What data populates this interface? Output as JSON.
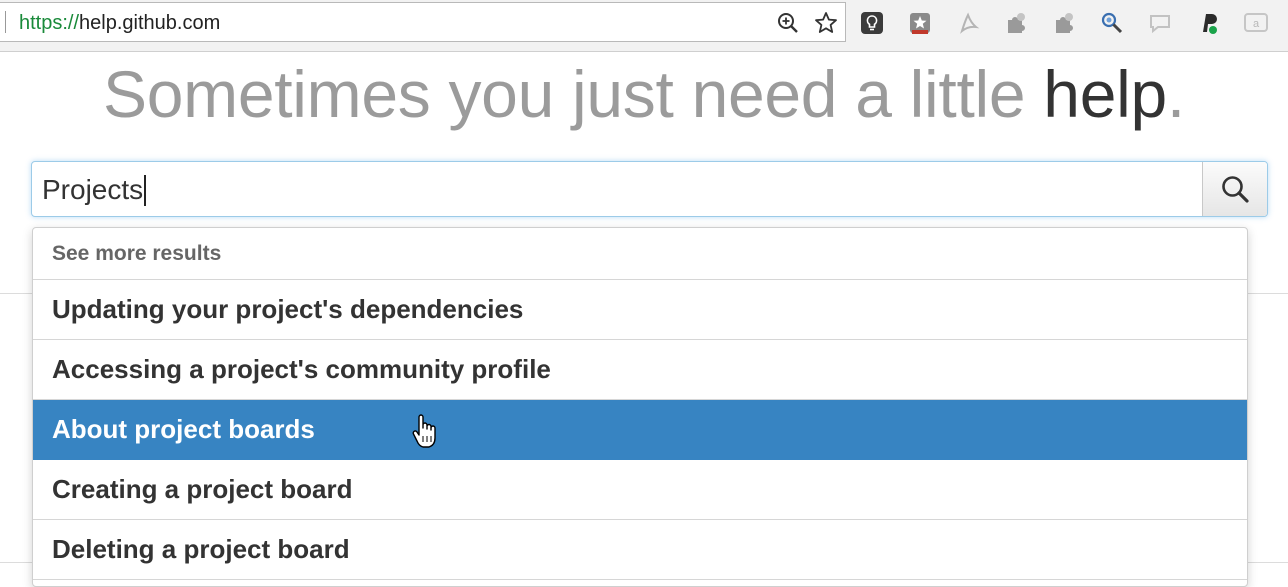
{
  "browser": {
    "url_scheme": "https://",
    "url_host": "help.github.com",
    "toolbar_icons": [
      "zoom-icon",
      "bookmark-star-icon"
    ],
    "extensions": [
      "lightbulb-extension-icon",
      "badge-extension-icon",
      "pdf-extension-icon",
      "puzzle-extension-icon",
      "puzzle-extension-icon-2",
      "search-bug-extension-icon",
      "chat-extension-icon",
      "paypal-extension-icon",
      "amazon-extension-icon"
    ]
  },
  "page": {
    "headline_light": "Sometimes you just need a little",
    "headline_strong": "help",
    "headline_end": "."
  },
  "search": {
    "value": "Projects",
    "button_icon": "search-icon"
  },
  "dropdown": {
    "see_more": "See more results",
    "results": [
      "Updating your project's dependencies",
      "Accessing a project's community profile",
      "About project boards",
      "Creating a project board",
      "Deleting a project board"
    ],
    "active_index": 2,
    "active_color": "#3784c2"
  },
  "colors": {
    "headline_light": "#9b9b9b",
    "headline_strong": "#333333",
    "url_scheme": "#1a8a3a"
  }
}
